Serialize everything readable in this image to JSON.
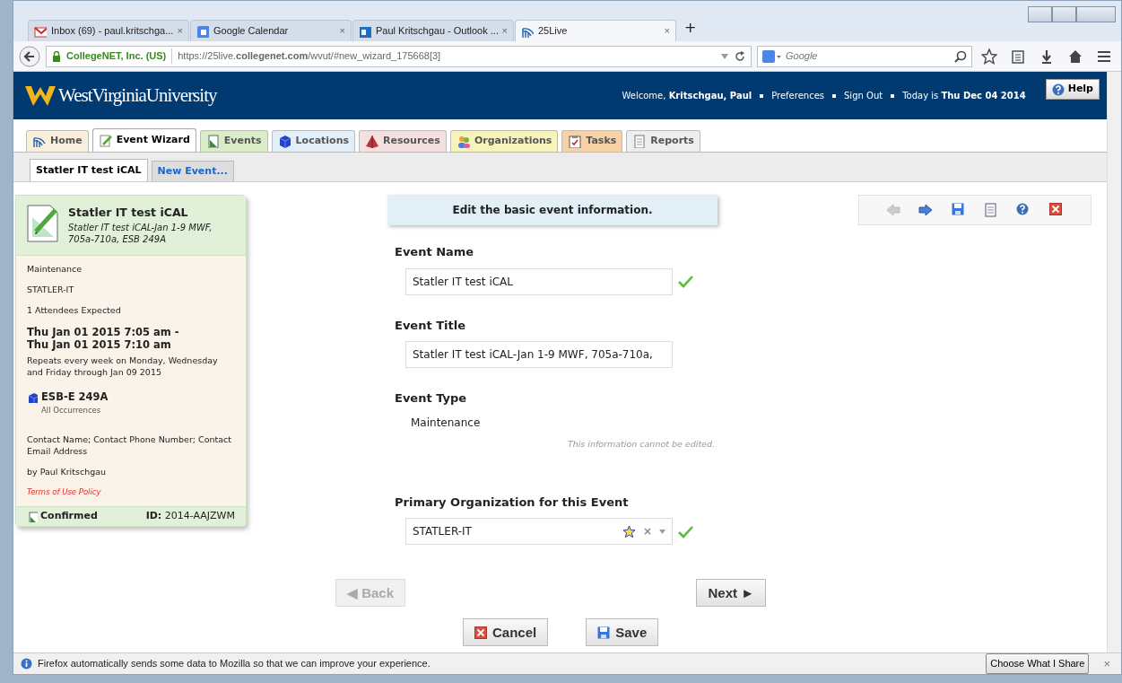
{
  "browser": {
    "tabs": [
      {
        "label": "Inbox (69) - paul.kritschga...",
        "kind": "mail",
        "selected": false,
        "close": "×"
      },
      {
        "label": "Google Calendar",
        "kind": "tile",
        "selected": false,
        "close": "×"
      },
      {
        "label": "Paul Kritschgau - Outlook ...",
        "kind": "office",
        "selected": false,
        "close": "×"
      },
      {
        "label": "25Live",
        "kind": "rays",
        "selected": true,
        "close": "×"
      }
    ],
    "new_tab": "+",
    "identity": "CollegeNET, Inc. (US)",
    "url": "https://25live.**collegenet.com**/wvut/#new_wizard_175668[3]",
    "search_placeholder": "Google"
  },
  "header": {
    "logo": "WestVirginiaUniversity",
    "welcome": "Welcome, **Kritschgau, Paul**",
    "links": [
      "Preferences",
      "Sign Out"
    ],
    "today": "Today is **Thu Dec 04 2014**",
    "help": "Help"
  },
  "module_tabs": [
    {
      "label": "Home",
      "kind": "rays",
      "color": "#faeedd",
      "selected": false
    },
    {
      "label": "Event Wizard",
      "kind": "pencil",
      "color": "#f4f4f4",
      "selected": true
    },
    {
      "label": "Events",
      "kind": "page",
      "color": "#d8edc8",
      "selected": false
    },
    {
      "label": "Locations",
      "kind": "cube",
      "color": "#e2eef8",
      "selected": false
    },
    {
      "label": "Resources",
      "kind": "pyramid",
      "color": "#f4e0e0",
      "selected": false
    },
    {
      "label": "Organizations",
      "kind": "people",
      "color": "#f6f4bb",
      "selected": false
    },
    {
      "label": "Tasks",
      "kind": "clipboard",
      "color": "#f6d2a6",
      "selected": false
    },
    {
      "label": "Reports",
      "kind": "report",
      "color": "#eeeeee",
      "selected": false
    }
  ],
  "sub_tabs": [
    {
      "label": "Statler IT test iCAL",
      "selected": true
    },
    {
      "label": "New Event...",
      "selected": false
    }
  ],
  "summary": {
    "title": "Statler IT test iCAL",
    "subtitle": "Statler IT test iCAL-Jan 1-9 MWF, 705a-710a, ESB 249A",
    "type": "Maintenance",
    "organization": "STATLER-IT",
    "attendees": "1 Attendees Expected",
    "time_lines": [
      "Thu Jan 01 2015 7:05 am -",
      "Thu Jan 01 2015 7:10 am"
    ],
    "repeat": "Repeats every week on Monday, Wednesday and Friday through Jan 09 2015",
    "location": "ESB-E 249A",
    "location_note": "All Occurrences",
    "contact": "Contact Name; Contact Phone Number; Contact Email Address",
    "author": "by Paul Kritschgau",
    "terms": "Terms of Use Policy",
    "state": "Confirmed",
    "id_label": "ID:",
    "id": "2014-AAJZWM"
  },
  "prompt": "Edit the basic event information.",
  "toolbar": [
    {
      "kind": "back",
      "disabled": true
    },
    {
      "kind": "forward",
      "disabled": false
    },
    {
      "kind": "save",
      "disabled": false
    },
    {
      "kind": "page",
      "disabled": false
    },
    {
      "kind": "help",
      "disabled": false
    },
    {
      "kind": "close",
      "disabled": false
    }
  ],
  "fields": [
    {
      "label": "Event Name",
      "kind": "text",
      "value": "Statler IT test iCAL",
      "valid": true
    },
    {
      "label": "Event Title",
      "kind": "text",
      "value": "Statler IT test iCAL-Jan 1-9 MWF, 705a-710a,",
      "valid": false
    },
    {
      "label": "Event Type",
      "kind": "readonly",
      "value": "Maintenance",
      "note": "This information cannot be edited."
    },
    {
      "label": "Primary Organization for this Event",
      "kind": "select",
      "value": "STATLER-IT",
      "clear": "×",
      "valid": true
    }
  ],
  "nav_buttons": [
    {
      "label": "◀ Back",
      "disabled": true
    },
    {
      "label": "Next ►",
      "disabled": false
    }
  ],
  "action_buttons": [
    {
      "label": "Cancel",
      "kind": "cancel"
    },
    {
      "label": "Save",
      "kind": "save"
    }
  ],
  "notification": {
    "text": "Firefox automatically sends some data to Mozilla so that we can improve your experience.",
    "button": "Choose What I Share",
    "close": "×"
  }
}
